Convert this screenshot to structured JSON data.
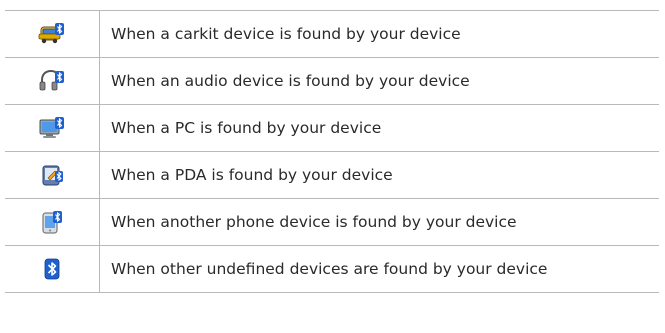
{
  "rows": [
    {
      "icon": "carkit-bluetooth-icon",
      "text": "When a carkit device is found by your device"
    },
    {
      "icon": "headset-bluetooth-icon",
      "text": "When an audio device is found by your device"
    },
    {
      "icon": "pc-bluetooth-icon",
      "text": "When a PC is found by your device"
    },
    {
      "icon": "pda-bluetooth-icon",
      "text": "When a PDA is found by your device"
    },
    {
      "icon": "phone-bluetooth-icon",
      "text": "When another phone device is found by your device"
    },
    {
      "icon": "bluetooth-icon",
      "text": "When other undefined devices are found by your device"
    }
  ],
  "colors": {
    "border": "#b9b9b9",
    "text": "#2a2a2a",
    "bluetooth_blue": "#1f5fcf"
  }
}
